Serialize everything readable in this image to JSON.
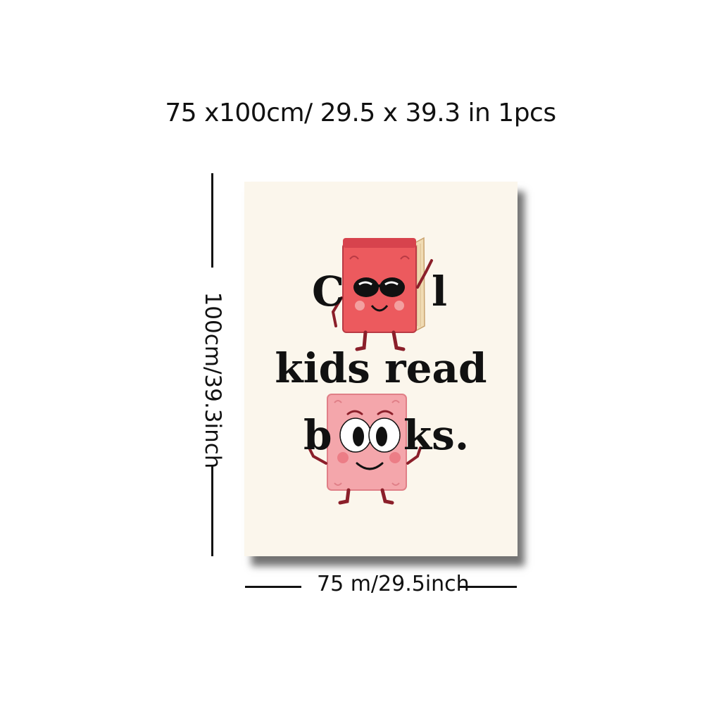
{
  "header": {
    "size_text": "75 x100cm/ 29.5 x 39.3 in 1pcs"
  },
  "dimensions": {
    "height_label": "100cm/39.3inch",
    "width_label": "75 m/29.5inch"
  },
  "poster": {
    "line1_start": "C",
    "line1_end": "l",
    "line2": "kids read",
    "line3_start": "b",
    "line3_end": "ks.",
    "colors": {
      "background": "#fbf6ec",
      "top_book": "#ec5a5e",
      "bottom_book": "#f4a6ab",
      "limbs": "#8b1f2a"
    }
  }
}
